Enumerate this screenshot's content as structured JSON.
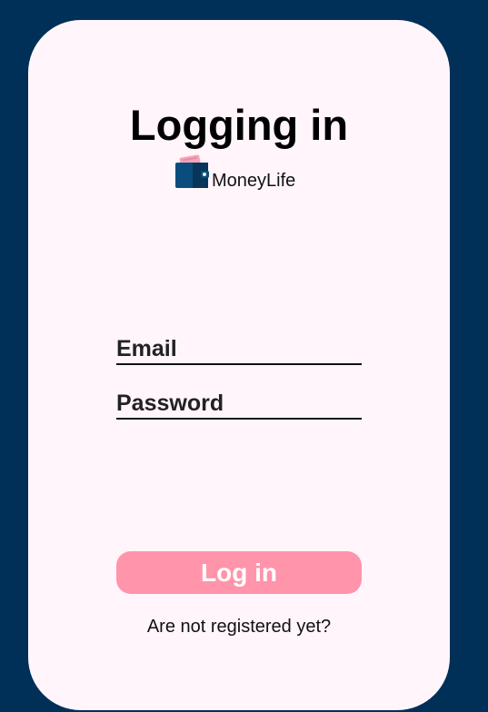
{
  "page": {
    "background_color": "#003057",
    "card_color": "#fff5fb"
  },
  "header": {
    "title": "Logging in",
    "brand_name": "MoneyLife",
    "brand_icon": "wallet-icon"
  },
  "form": {
    "email_placeholder": "Email",
    "email_value": "",
    "password_placeholder": "Password",
    "password_value": "",
    "login_label": "Log in",
    "login_button_color": "#ff94ab"
  },
  "footer": {
    "register_text": "Are not registered yet?"
  }
}
